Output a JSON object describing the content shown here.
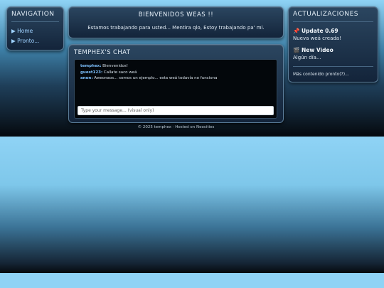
{
  "navigation": {
    "title": "NAVIGATION",
    "items": [
      {
        "label": "▶ Home"
      },
      {
        "label": "▶ Pronto..."
      }
    ]
  },
  "welcome": {
    "title": "BIENVENIDOS WEAS !!",
    "text": "Estamos trabajando para usted... Mentira qlo, Estoy trabajando pa' mi."
  },
  "chat": {
    "title": "TEMPHEX'S CHAT",
    "messages": [
      {
        "user": "temphex:",
        "text": " Bienvenidos!"
      },
      {
        "user": "guest123:",
        "text": " Callate saco weá"
      },
      {
        "user": "anon:",
        "text": " Aweonaos... somos un ejemplo... esta weá todavía no funciona"
      }
    ],
    "input_placeholder": "Type your message... (visual only)"
  },
  "updates": {
    "title": "ACTUALIZACIONES",
    "entries": [
      {
        "icon": "pin-icon",
        "glyph": "📌",
        "heading": "Update 0.69",
        "sub": "Nueva weá creada!"
      },
      {
        "icon": "clapper-icon",
        "glyph": "🎬",
        "heading": "New Video",
        "sub": "Algún día..."
      }
    ],
    "more": "Más contenido pronto(?)..."
  },
  "footer": "© 2025 temphex · Hosted on Neocities"
}
